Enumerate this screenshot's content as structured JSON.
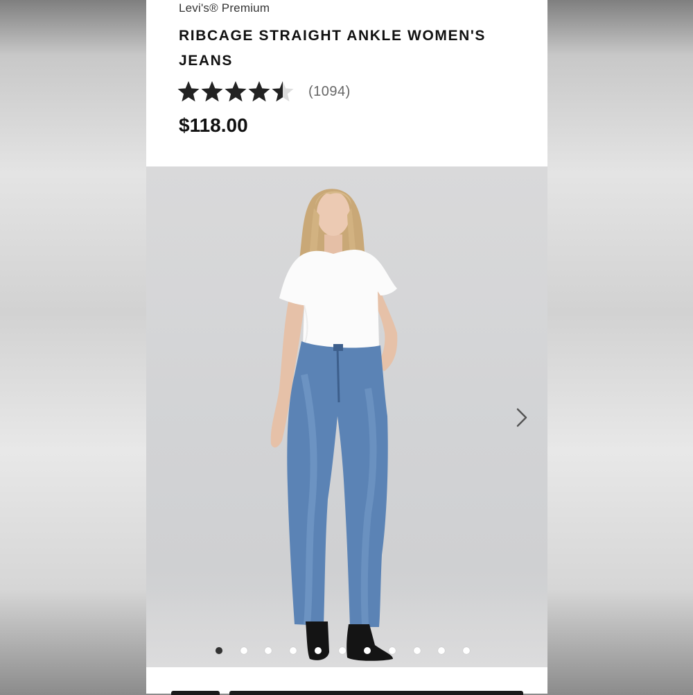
{
  "product": {
    "brand": "Levi's® Premium",
    "title": "RIBCAGE STRAIGHT ANKLE WOMEN'S JEANS",
    "rating": 4.5,
    "rating_max": 5,
    "review_count": "(1094)",
    "price": "$118.00"
  },
  "gallery": {
    "image_count": 11,
    "active_index": 0,
    "next_icon": "chevron-right-icon"
  },
  "colors": {
    "star_filled": "#222222",
    "star_empty": "#dddddd",
    "dot_active": "#333333",
    "dot_inactive": "#ffffff"
  }
}
